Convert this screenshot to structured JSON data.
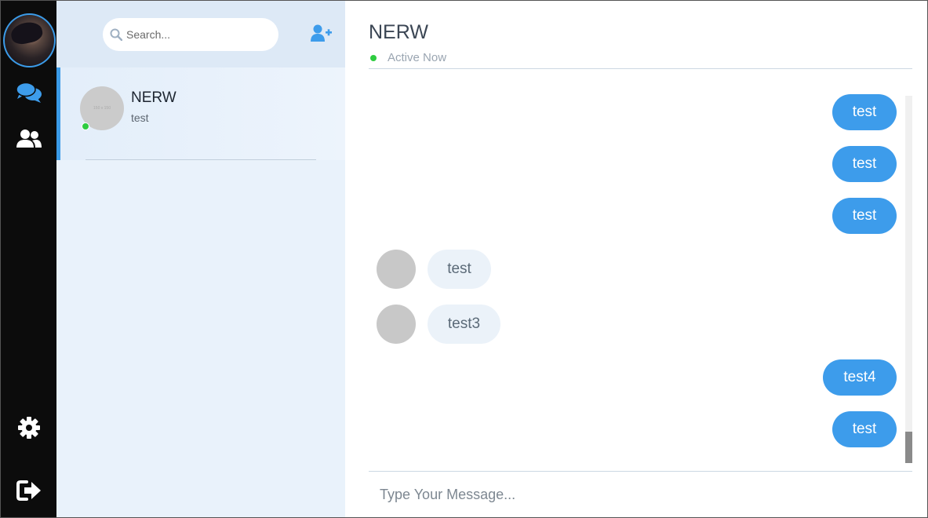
{
  "rail": {
    "avatar_icon": "user-avatar",
    "items": [
      {
        "icon": "chat-bubbles-icon",
        "active": true,
        "color": "#3d9ceb"
      },
      {
        "icon": "users-icon",
        "active": false,
        "color": "#ffffff"
      },
      {
        "icon": "gear-icon",
        "active": false,
        "color": "#ffffff"
      },
      {
        "icon": "sign-out-icon",
        "active": false,
        "color": "#ffffff"
      }
    ]
  },
  "sidebar": {
    "search": {
      "placeholder": "Search..."
    },
    "add_user_icon": "user-plus-icon",
    "contacts": [
      {
        "name": "NERW",
        "last_message": "test",
        "online": true,
        "avatar_text": "150 x 150"
      }
    ]
  },
  "chat": {
    "title": "NERW",
    "status": "Active Now",
    "messages": [
      {
        "direction": "out",
        "text": "test"
      },
      {
        "direction": "out",
        "text": "test"
      },
      {
        "direction": "out",
        "text": "test"
      },
      {
        "direction": "in",
        "text": "test"
      },
      {
        "direction": "in",
        "text": "test3"
      },
      {
        "direction": "out",
        "text": "test4"
      },
      {
        "direction": "out",
        "text": "test"
      }
    ],
    "input_placeholder": "Type Your Message..."
  },
  "colors": {
    "accent": "#3d9ceb",
    "rail_bg": "#0c0c0c",
    "sidebar_bg": "#e9f2fb",
    "online": "#2ecc40",
    "incoming_bubble": "#ebf2f9"
  }
}
